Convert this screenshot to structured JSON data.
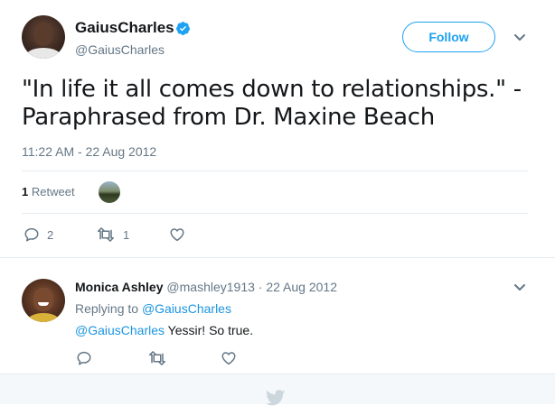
{
  "author": {
    "name": "GaiusCharles",
    "handle": "@GaiusCharles",
    "verified": true,
    "follow_label": "Follow"
  },
  "tweet": {
    "text": "\"In life it all comes down to relationships.\" - Paraphrased from Dr. Maxine Beach",
    "timestamp": "11:22 AM - 22 Aug 2012",
    "retweet_count": "1",
    "retweet_label": "Retweet",
    "actions": {
      "reply_count": "2",
      "retweet_count": "1",
      "like_count": ""
    }
  },
  "reply": {
    "name": "Monica Ashley",
    "handle": "@mashley1913",
    "separator": "·",
    "date": "22 Aug 2012",
    "replying_prefix": "Replying to",
    "replying_to": "@GaiusCharles",
    "mention": "@GaiusCharles",
    "text": "Yessir! So true."
  },
  "colors": {
    "accent": "#1da1f2",
    "link": "#1b95e0",
    "muted": "#657786",
    "text": "#14171a",
    "divider": "#e6ecf0"
  },
  "icons": {
    "verified": "verified-badge-icon",
    "menu": "chevron-down-icon",
    "reply": "reply-icon",
    "retweet": "retweet-icon",
    "like": "heart-icon",
    "footer": "twitter-bird-icon"
  }
}
